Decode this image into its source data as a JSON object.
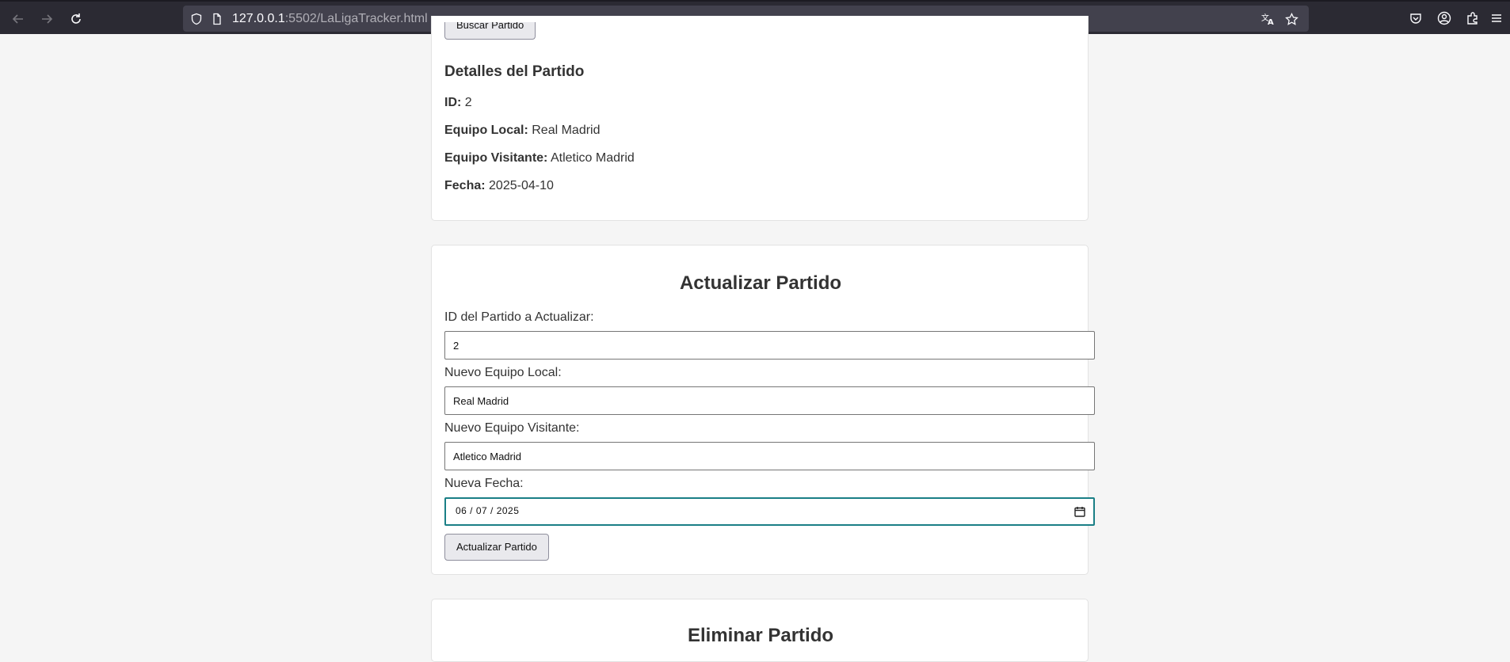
{
  "browser": {
    "url_host": "127.0.0.1",
    "url_rest": ":5502/LaLigaTracker.html"
  },
  "search_section": {
    "button_label": "Buscar Partido"
  },
  "details": {
    "heading": "Detalles del Partido",
    "id_label": "ID:",
    "id_value": "2",
    "home_label": "Equipo Local:",
    "home_value": "Real Madrid",
    "away_label": "Equipo Visitante:",
    "away_value": "Atletico Madrid",
    "date_label": "Fecha:",
    "date_value": "2025-04-10"
  },
  "update": {
    "title": "Actualizar Partido",
    "id_label": "ID del Partido a Actualizar:",
    "id_value": "2",
    "home_label": "Nuevo Equipo Local:",
    "home_value": "Real Madrid",
    "away_label": "Nuevo Equipo Visitante:",
    "away_value": "Atletico Madrid",
    "date_label": "Nueva Fecha:",
    "date_value": "06 / 07 / 2025",
    "button_label": "Actualizar Partido"
  },
  "delete": {
    "title": "Eliminar Partido"
  }
}
